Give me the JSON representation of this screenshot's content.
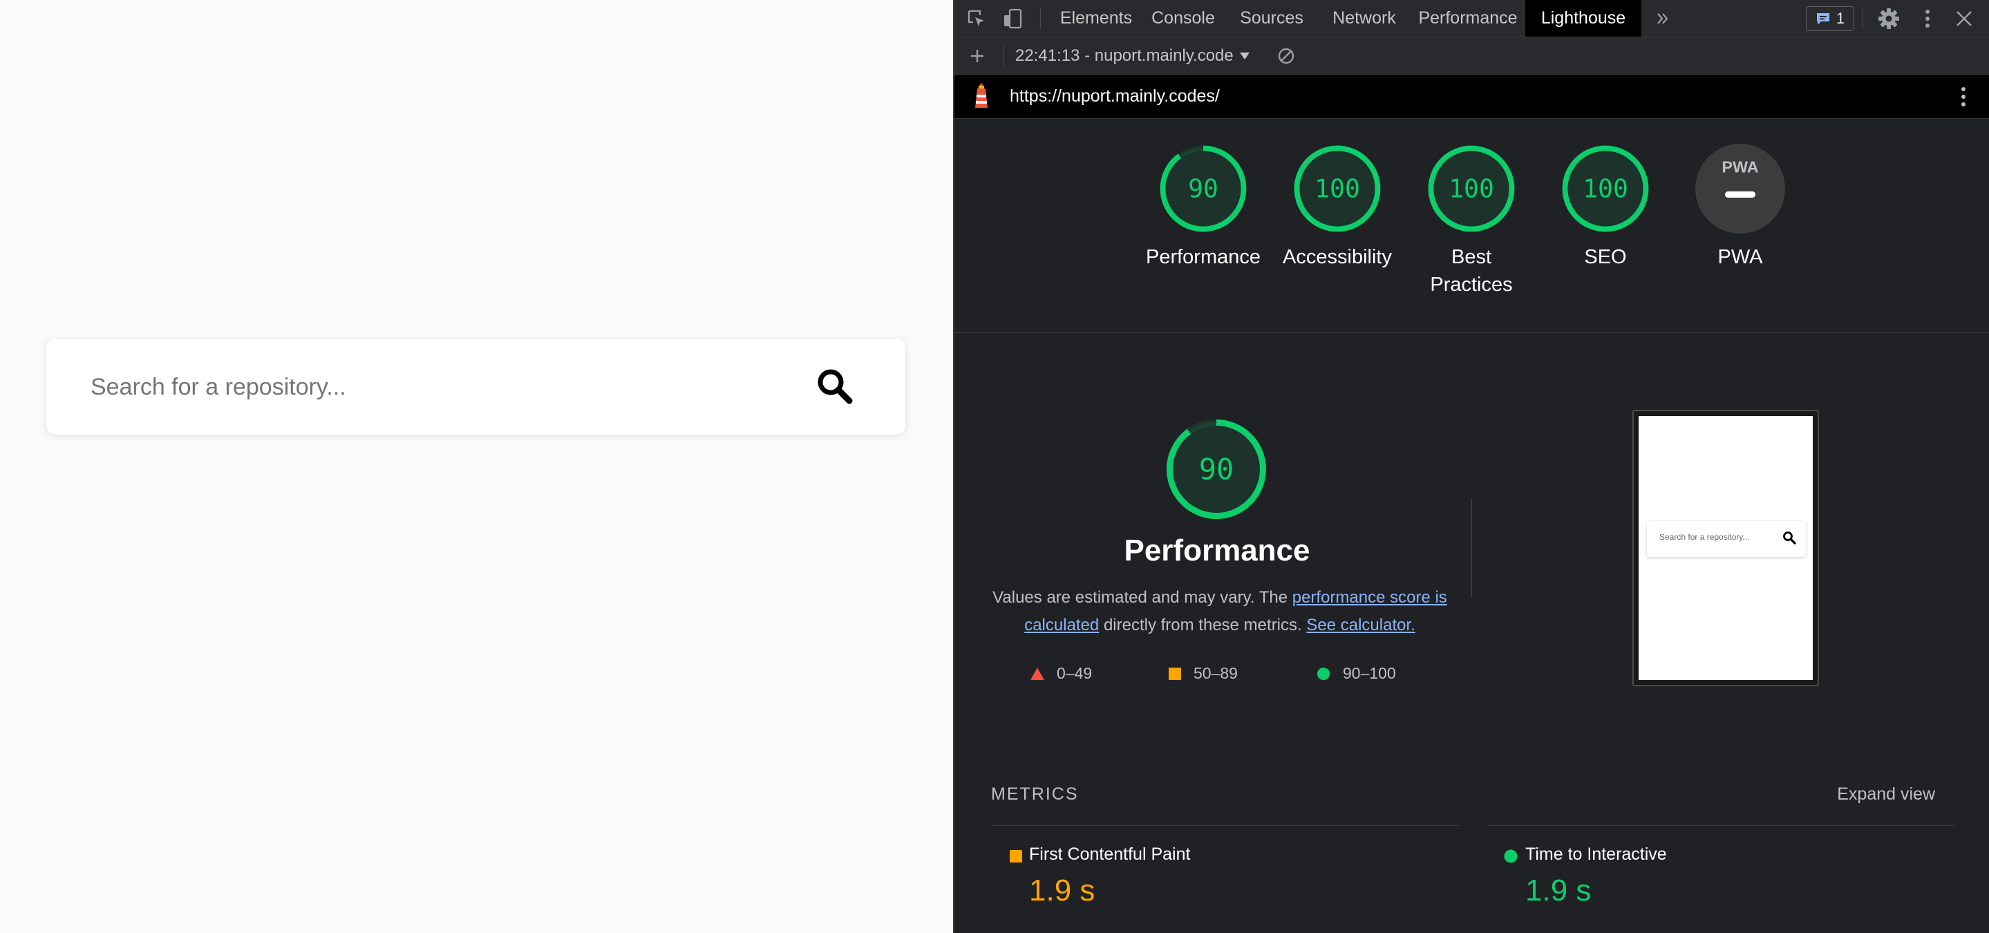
{
  "app": {
    "search": {
      "placeholder": "Search for a repository..."
    }
  },
  "devtools": {
    "tabs": [
      {
        "label": "Elements"
      },
      {
        "label": "Console"
      },
      {
        "label": "Sources"
      },
      {
        "label": "Network"
      },
      {
        "label": "Performance"
      },
      {
        "label": "Lighthouse",
        "active": true
      }
    ],
    "issues_count": "1",
    "report_select": "22:41:13 - nuport.mainly.code",
    "url": "https://nuport.mainly.codes/",
    "gauges": [
      {
        "label": "Performance",
        "score": "90",
        "value": 90
      },
      {
        "label": "Accessibility",
        "score": "100",
        "value": 100
      },
      {
        "label": "Best Practices",
        "score": "100",
        "value": 100
      },
      {
        "label": "SEO",
        "score": "100",
        "value": 100
      },
      {
        "label": "PWA",
        "score": "PWA",
        "value": null
      }
    ],
    "performance": {
      "score": "90",
      "title": "Performance",
      "desc_prefix": "Values are estimated and may vary. The ",
      "desc_link1": "performance score is calculated",
      "desc_middle": " directly from these metrics. ",
      "desc_link2": "See calculator.",
      "legend": [
        {
          "range": "0–49",
          "color": "#ff4e42"
        },
        {
          "range": "50–89",
          "color": "#ffa400"
        },
        {
          "range": "90–100",
          "color": "#0cce6b"
        }
      ],
      "screenshot_placeholder": "Search for a repository..."
    },
    "metrics": {
      "title": "METRICS",
      "expand_label": "Expand view",
      "items": [
        {
          "name": "First Contentful Paint",
          "value": "1.9 s",
          "color": "#ffa400"
        },
        {
          "name": "Time to Interactive",
          "value": "1.9 s",
          "color": "#0cce6b"
        }
      ]
    },
    "colors": {
      "pass": "#0cce6b",
      "average": "#ffa400",
      "fail": "#ff4e42",
      "background": "#202124"
    }
  }
}
